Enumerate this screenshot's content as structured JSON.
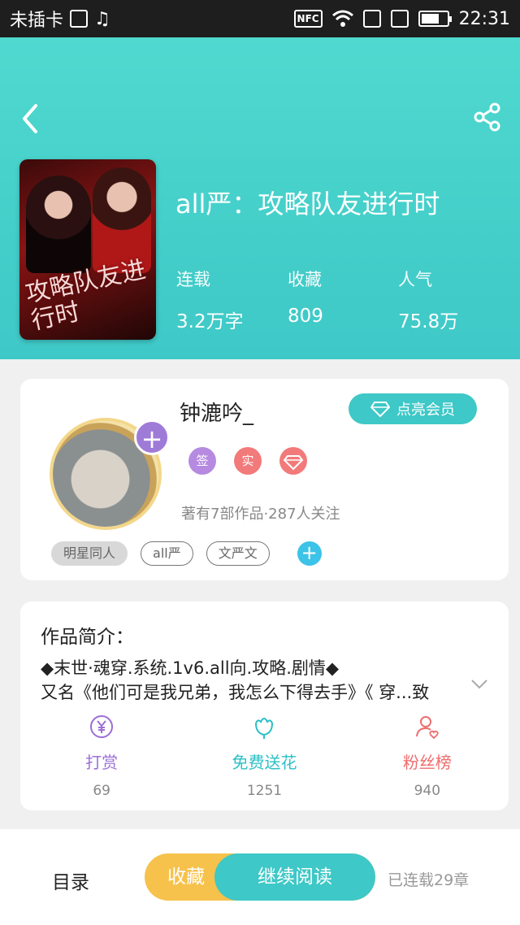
{
  "statusbar": {
    "carrier": "未插卡",
    "nfc": "NFC",
    "time": "22:31",
    "battery_level": 0.7
  },
  "header": {
    "icons": {
      "back": "back-chevron-icon",
      "share": "share-icon"
    },
    "cover_text": "攻略队友进行时",
    "title": "all严：攻略队友进行时",
    "stats": [
      {
        "label": "连载",
        "value": "3.2万字"
      },
      {
        "label": "收藏",
        "value": "809"
      },
      {
        "label": "人气",
        "value": "75.8万"
      }
    ]
  },
  "author": {
    "name": "钟漉吟_",
    "vip_label": "点亮会员",
    "badges": [
      "签",
      "实"
    ],
    "meta": "著有7部作品·287人关注",
    "tags": [
      "明星同人",
      "all严",
      "文严文"
    ]
  },
  "intro": {
    "title": "作品简介：",
    "line1": "◆末世·魂穿.系统.1v6.all向.攻略.剧情◆",
    "line2": "又名《他们可是我兄弟，我怎么下得去手》《 穿...致"
  },
  "actions": [
    {
      "label": "打赏",
      "count": "69",
      "color": "#9b6fd6",
      "icon": "yen-coin-icon"
    },
    {
      "label": "免费送花",
      "count": "1251",
      "color": "#2cc0c6",
      "icon": "flower-icon"
    },
    {
      "label": "粉丝榜",
      "count": "940",
      "color": "#ee6d6d",
      "icon": "fan-ranking-icon"
    }
  ],
  "bottom": {
    "toc_label": "目录",
    "fav_label": "收藏",
    "read_label": "继续阅读",
    "chapters": "已连载29章"
  },
  "colors": {
    "accent": "#3ec8c7",
    "favorite": "#f6c24c"
  }
}
